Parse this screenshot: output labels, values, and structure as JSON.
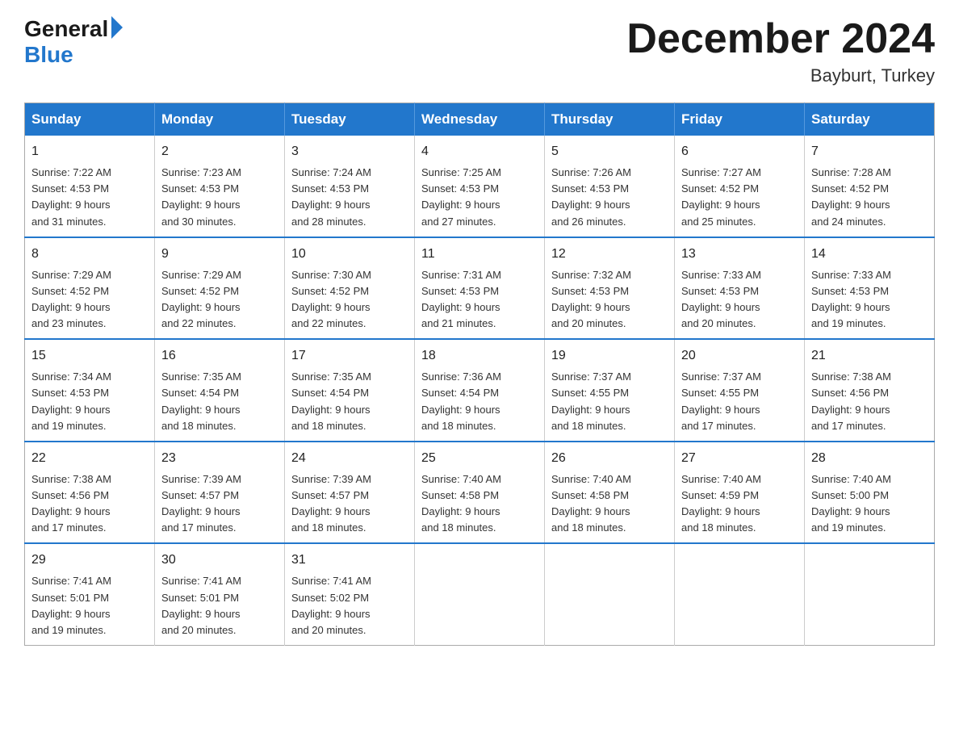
{
  "logo": {
    "general": "General",
    "blue": "Blue"
  },
  "title": "December 2024",
  "subtitle": "Bayburt, Turkey",
  "weekdays": [
    "Sunday",
    "Monday",
    "Tuesday",
    "Wednesday",
    "Thursday",
    "Friday",
    "Saturday"
  ],
  "weeks": [
    [
      {
        "day": "1",
        "sunrise": "7:22 AM",
        "sunset": "4:53 PM",
        "daylight": "9 hours and 31 minutes."
      },
      {
        "day": "2",
        "sunrise": "7:23 AM",
        "sunset": "4:53 PM",
        "daylight": "9 hours and 30 minutes."
      },
      {
        "day": "3",
        "sunrise": "7:24 AM",
        "sunset": "4:53 PM",
        "daylight": "9 hours and 28 minutes."
      },
      {
        "day": "4",
        "sunrise": "7:25 AM",
        "sunset": "4:53 PM",
        "daylight": "9 hours and 27 minutes."
      },
      {
        "day": "5",
        "sunrise": "7:26 AM",
        "sunset": "4:53 PM",
        "daylight": "9 hours and 26 minutes."
      },
      {
        "day": "6",
        "sunrise": "7:27 AM",
        "sunset": "4:52 PM",
        "daylight": "9 hours and 25 minutes."
      },
      {
        "day": "7",
        "sunrise": "7:28 AM",
        "sunset": "4:52 PM",
        "daylight": "9 hours and 24 minutes."
      }
    ],
    [
      {
        "day": "8",
        "sunrise": "7:29 AM",
        "sunset": "4:52 PM",
        "daylight": "9 hours and 23 minutes."
      },
      {
        "day": "9",
        "sunrise": "7:29 AM",
        "sunset": "4:52 PM",
        "daylight": "9 hours and 22 minutes."
      },
      {
        "day": "10",
        "sunrise": "7:30 AM",
        "sunset": "4:52 PM",
        "daylight": "9 hours and 22 minutes."
      },
      {
        "day": "11",
        "sunrise": "7:31 AM",
        "sunset": "4:53 PM",
        "daylight": "9 hours and 21 minutes."
      },
      {
        "day": "12",
        "sunrise": "7:32 AM",
        "sunset": "4:53 PM",
        "daylight": "9 hours and 20 minutes."
      },
      {
        "day": "13",
        "sunrise": "7:33 AM",
        "sunset": "4:53 PM",
        "daylight": "9 hours and 20 minutes."
      },
      {
        "day": "14",
        "sunrise": "7:33 AM",
        "sunset": "4:53 PM",
        "daylight": "9 hours and 19 minutes."
      }
    ],
    [
      {
        "day": "15",
        "sunrise": "7:34 AM",
        "sunset": "4:53 PM",
        "daylight": "9 hours and 19 minutes."
      },
      {
        "day": "16",
        "sunrise": "7:35 AM",
        "sunset": "4:54 PM",
        "daylight": "9 hours and 18 minutes."
      },
      {
        "day": "17",
        "sunrise": "7:35 AM",
        "sunset": "4:54 PM",
        "daylight": "9 hours and 18 minutes."
      },
      {
        "day": "18",
        "sunrise": "7:36 AM",
        "sunset": "4:54 PM",
        "daylight": "9 hours and 18 minutes."
      },
      {
        "day": "19",
        "sunrise": "7:37 AM",
        "sunset": "4:55 PM",
        "daylight": "9 hours and 18 minutes."
      },
      {
        "day": "20",
        "sunrise": "7:37 AM",
        "sunset": "4:55 PM",
        "daylight": "9 hours and 17 minutes."
      },
      {
        "day": "21",
        "sunrise": "7:38 AM",
        "sunset": "4:56 PM",
        "daylight": "9 hours and 17 minutes."
      }
    ],
    [
      {
        "day": "22",
        "sunrise": "7:38 AM",
        "sunset": "4:56 PM",
        "daylight": "9 hours and 17 minutes."
      },
      {
        "day": "23",
        "sunrise": "7:39 AM",
        "sunset": "4:57 PM",
        "daylight": "9 hours and 17 minutes."
      },
      {
        "day": "24",
        "sunrise": "7:39 AM",
        "sunset": "4:57 PM",
        "daylight": "9 hours and 18 minutes."
      },
      {
        "day": "25",
        "sunrise": "7:40 AM",
        "sunset": "4:58 PM",
        "daylight": "9 hours and 18 minutes."
      },
      {
        "day": "26",
        "sunrise": "7:40 AM",
        "sunset": "4:58 PM",
        "daylight": "9 hours and 18 minutes."
      },
      {
        "day": "27",
        "sunrise": "7:40 AM",
        "sunset": "4:59 PM",
        "daylight": "9 hours and 18 minutes."
      },
      {
        "day": "28",
        "sunrise": "7:40 AM",
        "sunset": "5:00 PM",
        "daylight": "9 hours and 19 minutes."
      }
    ],
    [
      {
        "day": "29",
        "sunrise": "7:41 AM",
        "sunset": "5:01 PM",
        "daylight": "9 hours and 19 minutes."
      },
      {
        "day": "30",
        "sunrise": "7:41 AM",
        "sunset": "5:01 PM",
        "daylight": "9 hours and 20 minutes."
      },
      {
        "day": "31",
        "sunrise": "7:41 AM",
        "sunset": "5:02 PM",
        "daylight": "9 hours and 20 minutes."
      },
      null,
      null,
      null,
      null
    ]
  ],
  "labels": {
    "sunrise": "Sunrise:",
    "sunset": "Sunset:",
    "daylight": "Daylight:"
  }
}
